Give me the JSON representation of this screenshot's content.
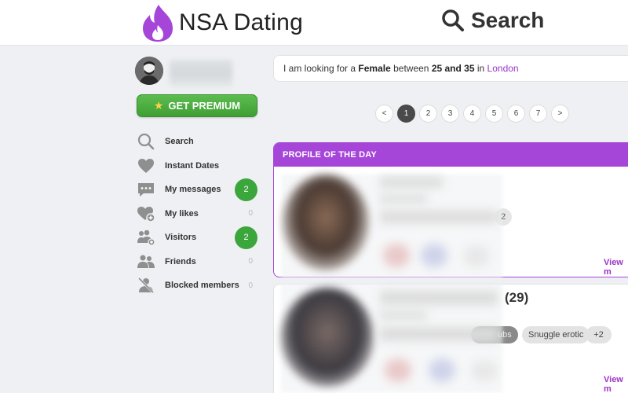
{
  "header": {
    "logo_text": "NSA Dating",
    "search_label": "Search"
  },
  "sidebar": {
    "premium_label": "GET PREMIUM",
    "items": [
      {
        "label": "Search",
        "icon": "search-icon",
        "count": "",
        "badge": ""
      },
      {
        "label": "Instant Dates",
        "icon": "heart-icon",
        "count": "",
        "badge": ""
      },
      {
        "label": "My messages",
        "icon": "chat-icon",
        "count": "",
        "badge": "2"
      },
      {
        "label": "My likes",
        "icon": "heart-plus-icon",
        "count": "0",
        "badge": ""
      },
      {
        "label": "Visitors",
        "icon": "visitors-icon",
        "count": "",
        "badge": "2"
      },
      {
        "label": "Friends",
        "icon": "friends-icon",
        "count": "0",
        "badge": ""
      },
      {
        "label": "Blocked members",
        "icon": "blocked-user-icon",
        "count": "0",
        "badge": ""
      }
    ]
  },
  "search_bar": {
    "prefix": "I am looking for a",
    "gender": "Female",
    "between": "between",
    "age_range": "25 and 35",
    "in": "in",
    "city": "London"
  },
  "pagination": {
    "prev": "<",
    "pages": [
      "1",
      "2",
      "3",
      "4",
      "5",
      "6",
      "7"
    ],
    "active": "1",
    "next": ">"
  },
  "profile_of_the_day": {
    "header": "PROFILE OF THE DAY",
    "tag_count": "2",
    "view_more": "View m"
  },
  "second_card": {
    "age": "(29)",
    "tags": [
      "ubs",
      "Snuggle erotic",
      "+2"
    ],
    "view_more": "View m"
  },
  "colors": {
    "accent": "#a546d9",
    "accent_text": "#9b35c9",
    "badge_green": "#3aa63b",
    "premium_green": "#4caf41"
  }
}
